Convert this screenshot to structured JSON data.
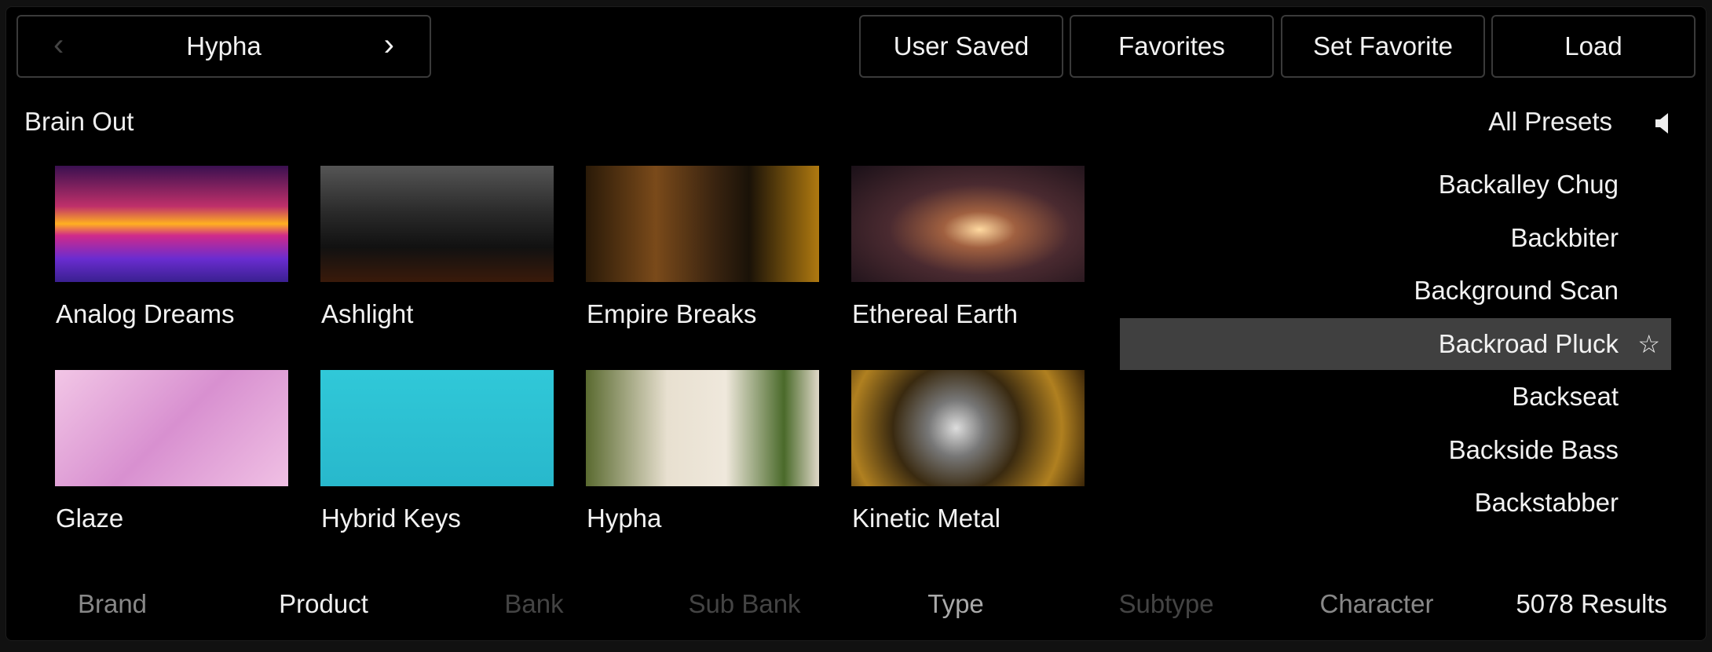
{
  "header": {
    "current_product": "Hypha",
    "prev_icon": "chevron-left-icon",
    "next_icon": "chevron-right-icon",
    "buttons": [
      "User Saved",
      "Favorites",
      "Set Favorite",
      "Load"
    ]
  },
  "bank_label": "Brain Out",
  "preset_scope": "All Presets",
  "speaker_icon": "speaker-icon",
  "tiles": [
    {
      "name": "Analog Dreams",
      "thumb": "linear-gradient(180deg,#3a1050 0%,#c0306a 35%,#ffb020 50%,#d02a8a 60%,#6a2cd0 80%,#3a2090 100%)"
    },
    {
      "name": "Ashlight",
      "thumb": "linear-gradient(180deg,#555 0%,#2a2a2a 40%,#111 70%,#3a1a0a 100%)"
    },
    {
      "name": "Empire Breaks",
      "thumb": "linear-gradient(90deg,#2a1a08 0%,#7a4a1a 30%,#3a2410 55%,#1a1208 70%,#b07a10 100%)"
    },
    {
      "name": "Ethereal Earth",
      "thumb": "radial-gradient(ellipse at 55% 55%,#ffd9a0 0%,#a06040 20%,#4a2a30 50%,#1a1018 100%)"
    },
    {
      "name": "Glaze",
      "thumb": "linear-gradient(135deg,#f2c6e6 0%,#d890d0 50%,#f0c0e4 100%)"
    },
    {
      "name": "Hybrid Keys",
      "thumb": "linear-gradient(180deg,#30c8d8 0%,#28b8cc 100%)"
    },
    {
      "name": "Hypha",
      "thumb": "linear-gradient(90deg,#5a6a30 0%,#e8e0d0 35%,#efe8dc 60%,#4a6a2a 85%,#e0d8c8 100%)"
    },
    {
      "name": "Kinetic Metal",
      "thumb": "radial-gradient(circle at 45% 50%,#ddd 0%,#777 20%,#3a2a10 45%,#b08020 75%,#3a2508 100%)"
    }
  ],
  "presets": [
    {
      "name": "Backalley Chug",
      "selected": false
    },
    {
      "name": "Backbiter",
      "selected": false
    },
    {
      "name": "Background Scan",
      "selected": false
    },
    {
      "name": "Backroad Pluck",
      "selected": true,
      "star_icon": "star-outline-icon",
      "star": "☆"
    },
    {
      "name": "Backseat",
      "selected": false
    },
    {
      "name": "Backside Bass",
      "selected": false
    },
    {
      "name": "Backstabber",
      "selected": false
    }
  ],
  "filters": [
    {
      "label": "Brand",
      "color": "#888888"
    },
    {
      "label": "Product",
      "color": "#eeeeee"
    },
    {
      "label": "Bank",
      "color": "#444444"
    },
    {
      "label": "Sub Bank",
      "color": "#444444"
    },
    {
      "label": "Type",
      "color": "#aaaaaa"
    },
    {
      "label": "Subtype",
      "color": "#444444"
    },
    {
      "label": "Character",
      "color": "#888888"
    }
  ],
  "results": "5078 Results",
  "colors": {
    "selection": "#404040",
    "background": "#000000"
  }
}
